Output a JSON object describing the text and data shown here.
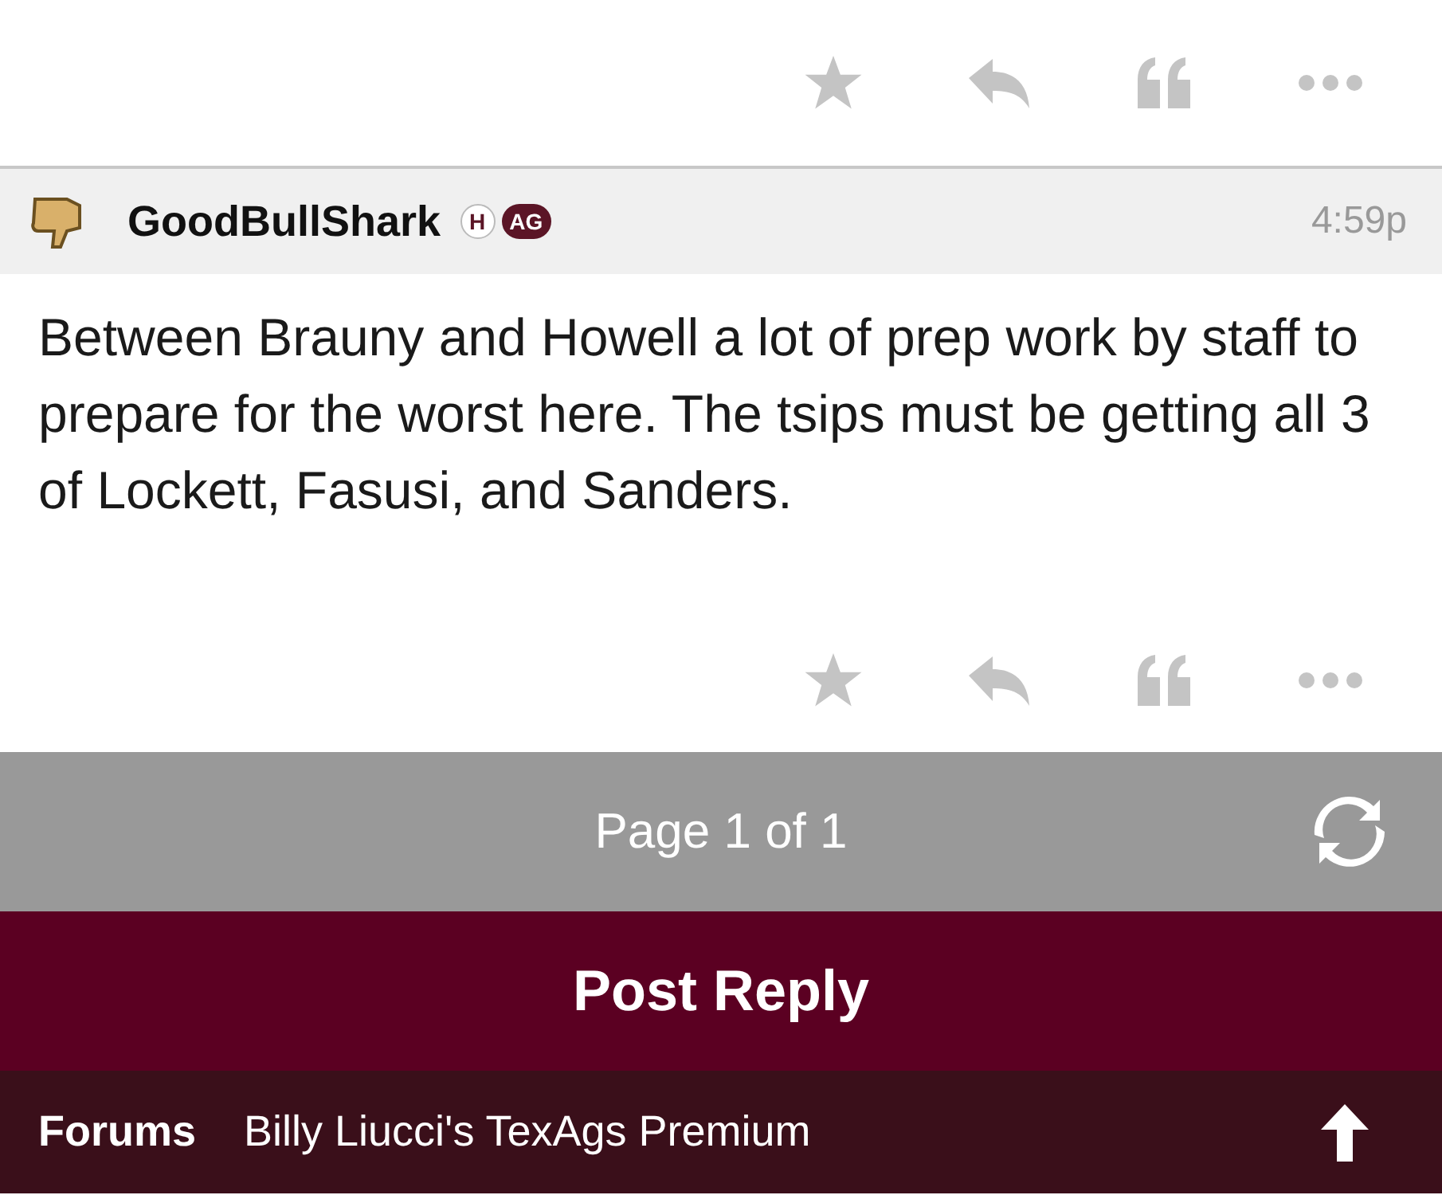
{
  "post": {
    "author": "GoodBullShark",
    "badges": [
      {
        "label": "H",
        "kind": "outline"
      },
      {
        "label": "AG",
        "kind": "filled"
      }
    ],
    "time": "4:59p",
    "body": "Between Brauny and Howell a lot of prep work by staff to prepare for the worst here. The tsips must be getting all 3 of Lockett, Fasusi, and Sanders."
  },
  "pager": {
    "label": "Page 1 of 1"
  },
  "reply_button": {
    "label": "Post Reply"
  },
  "footer": {
    "section": "Forums",
    "forum": "Billy Liucci's TexAgs Premium"
  }
}
